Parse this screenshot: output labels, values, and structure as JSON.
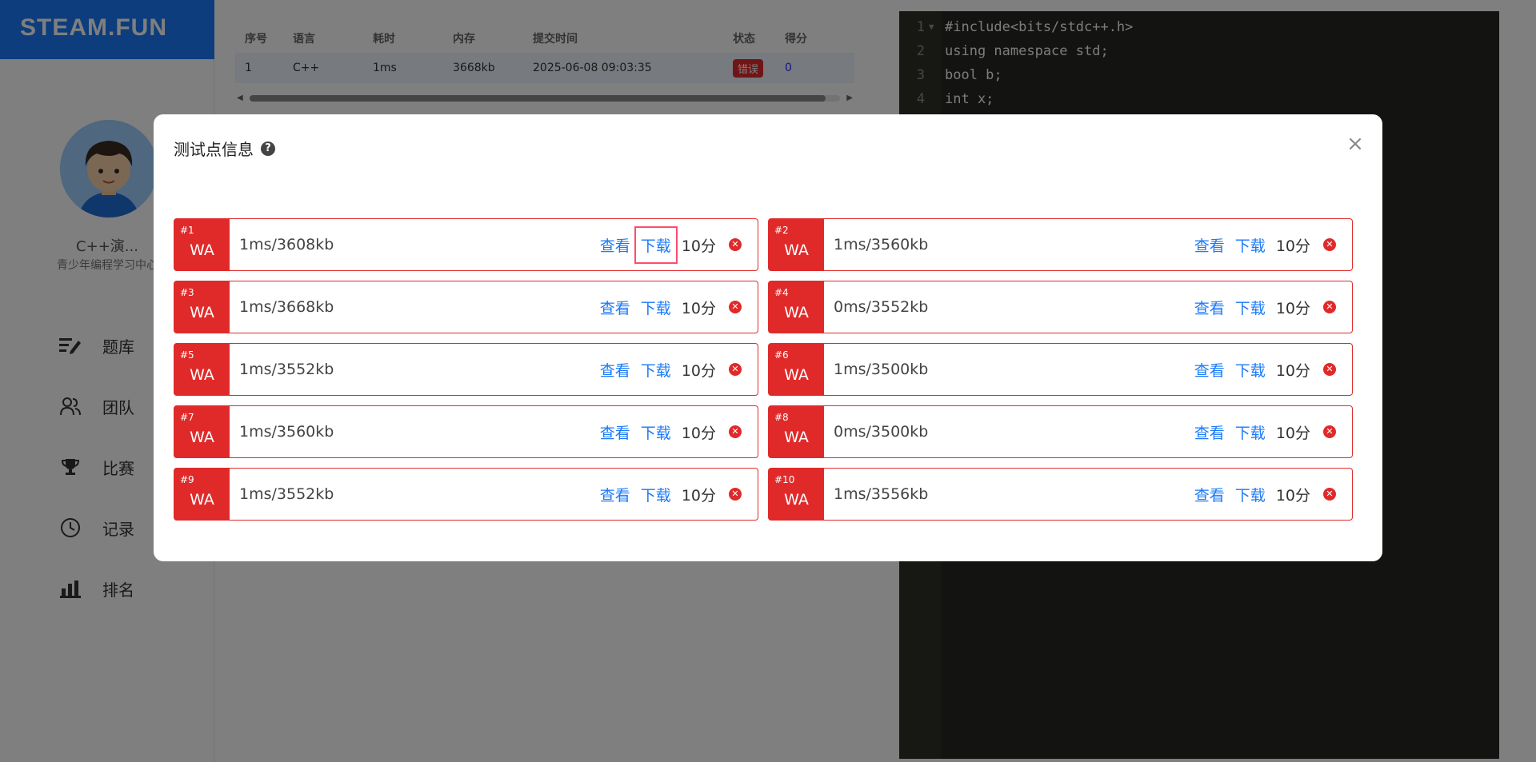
{
  "brand": {
    "name": "STEAM.FUN"
  },
  "user": {
    "name": "C++演...",
    "subtitle": "青少年编程学习中心"
  },
  "nav": [
    {
      "label": "题库",
      "icon": "edit-list-icon"
    },
    {
      "label": "团队",
      "icon": "team-icon"
    },
    {
      "label": "比赛",
      "icon": "trophy-icon"
    },
    {
      "label": "记录",
      "icon": "clock-icon"
    },
    {
      "label": "排名",
      "icon": "bar-chart-icon"
    }
  ],
  "submission_table": {
    "headers": [
      "序号",
      "语言",
      "耗时",
      "内存",
      "提交时间",
      "状态",
      "得分"
    ],
    "row": {
      "index": "1",
      "language": "C++",
      "time": "1ms",
      "memory": "3668kb",
      "submitted": "2025-06-08 09:03:35",
      "status": "错误",
      "score": "0"
    }
  },
  "editor": {
    "lines": [
      {
        "num": "1",
        "text": "#include<bits/stdc++.h>"
      },
      {
        "num": "2",
        "text": "using namespace std;"
      },
      {
        "num": "3",
        "text": "bool b;"
      },
      {
        "num": "4",
        "text": "int x;"
      }
    ]
  },
  "dialog": {
    "title": "测试点信息",
    "help_symbol": "?",
    "close_symbol": "×",
    "view_label": "查看",
    "download_label": "下载",
    "cases": [
      {
        "num": "#1",
        "status": "WA",
        "info": "1ms/3608kb",
        "score": "10分"
      },
      {
        "num": "#2",
        "status": "WA",
        "info": "1ms/3560kb",
        "score": "10分"
      },
      {
        "num": "#3",
        "status": "WA",
        "info": "1ms/3668kb",
        "score": "10分"
      },
      {
        "num": "#4",
        "status": "WA",
        "info": "0ms/3552kb",
        "score": "10分"
      },
      {
        "num": "#5",
        "status": "WA",
        "info": "1ms/3552kb",
        "score": "10分"
      },
      {
        "num": "#6",
        "status": "WA",
        "info": "1ms/3500kb",
        "score": "10分"
      },
      {
        "num": "#7",
        "status": "WA",
        "info": "1ms/3560kb",
        "score": "10分"
      },
      {
        "num": "#8",
        "status": "WA",
        "info": "0ms/3500kb",
        "score": "10分"
      },
      {
        "num": "#9",
        "status": "WA",
        "info": "1ms/3552kb",
        "score": "10分"
      },
      {
        "num": "#10",
        "status": "WA",
        "info": "1ms/3556kb",
        "score": "10分"
      }
    ]
  },
  "colors": {
    "brand": "#1a7af8",
    "error": "#e02a2a",
    "link": "#1a7af8",
    "editor_bg": "#272822"
  }
}
